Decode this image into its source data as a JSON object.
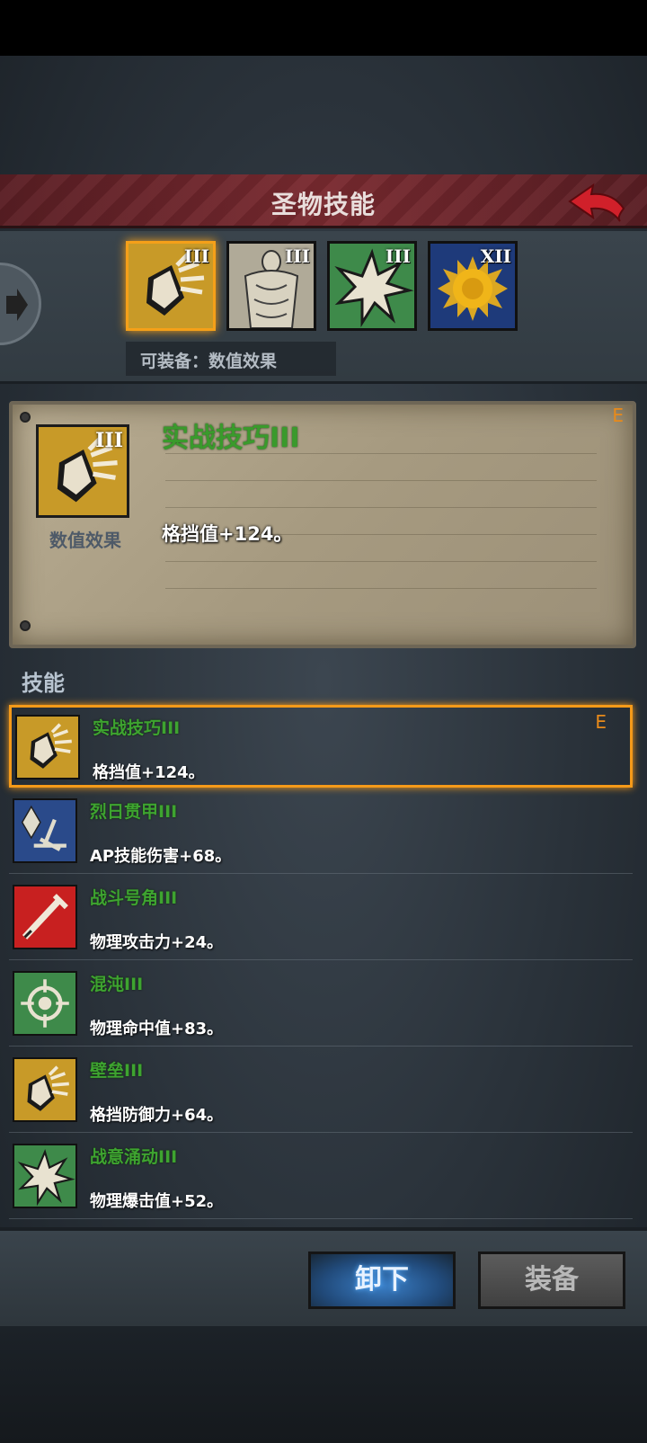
{
  "header": {
    "title": "圣物技能",
    "back_icon": "back-arrow-icon"
  },
  "tabs": [
    {
      "icon": "shield-fist-icon",
      "rank": "III",
      "selected": true,
      "color": "#c89a28"
    },
    {
      "icon": "armor-torso-icon",
      "rank": "III",
      "selected": false,
      "color": "#a09a88"
    },
    {
      "icon": "burst-star-icon",
      "rank": "III",
      "selected": false,
      "color": "#3e8a4a"
    },
    {
      "icon": "sun-emblem-icon",
      "rank": "XII",
      "selected": false,
      "color": "#1e3a7a"
    }
  ],
  "equip_hint": "可装备：数值效果",
  "detail": {
    "name": "实战技巧III",
    "type": "数值效果",
    "rank": "III",
    "effect": "格挡值+124。",
    "grade": "E"
  },
  "list_header": "技能",
  "skills": [
    {
      "name": "实战技巧III",
      "effect": "格挡值+124。",
      "grade": "E",
      "icon": "shield-fist-icon",
      "selected": true
    },
    {
      "name": "烈日贯甲III",
      "effect": "AP技能伤害+68。",
      "icon": "crystal-sword-icon"
    },
    {
      "name": "战斗号角III",
      "effect": "物理攻击力+24。",
      "icon": "sword-icon"
    },
    {
      "name": "混沌III",
      "effect": "物理命中值+83。",
      "icon": "crosshair-icon"
    },
    {
      "name": "壁垒III",
      "effect": "格挡防御力+64。",
      "icon": "shield-fist-icon"
    },
    {
      "name": "战意涌动III",
      "effect": "物理爆击值+52。",
      "icon": "burst-star-icon"
    }
  ],
  "buttons": {
    "unequip": "卸下",
    "equip": "装备"
  }
}
